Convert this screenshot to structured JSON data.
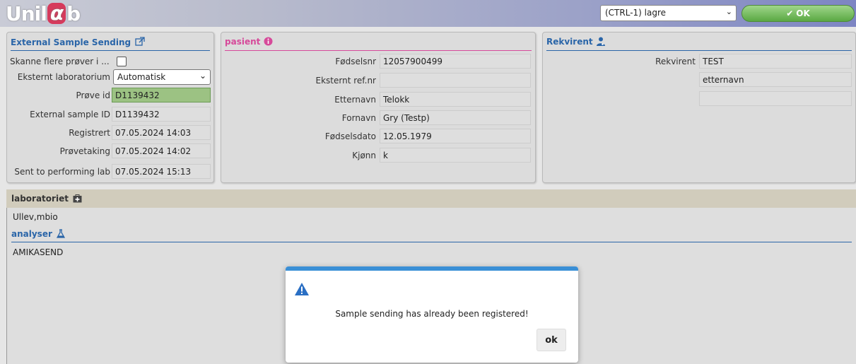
{
  "app": {
    "logo_left": "Unil",
    "logo_alpha": "α",
    "logo_right": "b"
  },
  "toolbar": {
    "action_select_value": "(CTRL-1) lagre",
    "ok_label": "OK"
  },
  "colors": {
    "accent_blue": "#2a65a8",
    "patient_pink": "#d64a9a",
    "ok_green": "#5aa843",
    "modal_bar": "#3a8fd6",
    "prove_id_green": "#9cc283"
  },
  "external": {
    "title": "External Sample Sending",
    "title_icon": "external-link-icon",
    "fields": [
      {
        "label": "Skanne flere prøver i ...",
        "type": "checkbox",
        "checked": false
      },
      {
        "label": "Eksternt laboratorium",
        "type": "select",
        "value": "Automatisk"
      },
      {
        "label": "Prøve id",
        "type": "input",
        "value": "D1139432",
        "highlight": true
      },
      {
        "label": "External sample ID",
        "type": "text",
        "value": "D1139432"
      },
      {
        "label": "Registrert",
        "type": "text",
        "value": "07.05.2024 14:03"
      },
      {
        "label": "Prøvetaking",
        "type": "text",
        "value": "07.05.2024 14:02"
      },
      {
        "label": "Sent to performing lab",
        "type": "text",
        "value": "07.05.2024 15:13"
      }
    ]
  },
  "patient": {
    "title": "pasient",
    "title_icon": "info-icon",
    "fields": [
      {
        "label": "Fødselsnr",
        "value": "12057900499"
      },
      {
        "label": "Eksternt ref.nr",
        "value": ""
      },
      {
        "label": "Etternavn",
        "value": "Telokk"
      },
      {
        "label": "Fornavn",
        "value": "Gry (Testp)"
      },
      {
        "label": "Fødselsdato",
        "value": "12.05.1979"
      },
      {
        "label": "Kjønn",
        "value": "k"
      }
    ]
  },
  "rekvirent": {
    "title": "Rekvirent",
    "title_icon": "doctor-icon",
    "fields": [
      {
        "label": "Rekvirent",
        "value": "TEST"
      },
      {
        "label": "",
        "value": "etternavn"
      },
      {
        "label": "",
        "value": ""
      }
    ]
  },
  "laboratory": {
    "title": "laboratoriet",
    "title_icon": "hospital-icon",
    "value": "Ullev,mbio"
  },
  "analyses": {
    "title": "analyser",
    "title_icon": "flask-icon",
    "items": [
      "AMIKASEND"
    ]
  },
  "dialog": {
    "icon": "warning-icon",
    "message": "Sample sending has already been registered!",
    "ok_label": "ok"
  }
}
